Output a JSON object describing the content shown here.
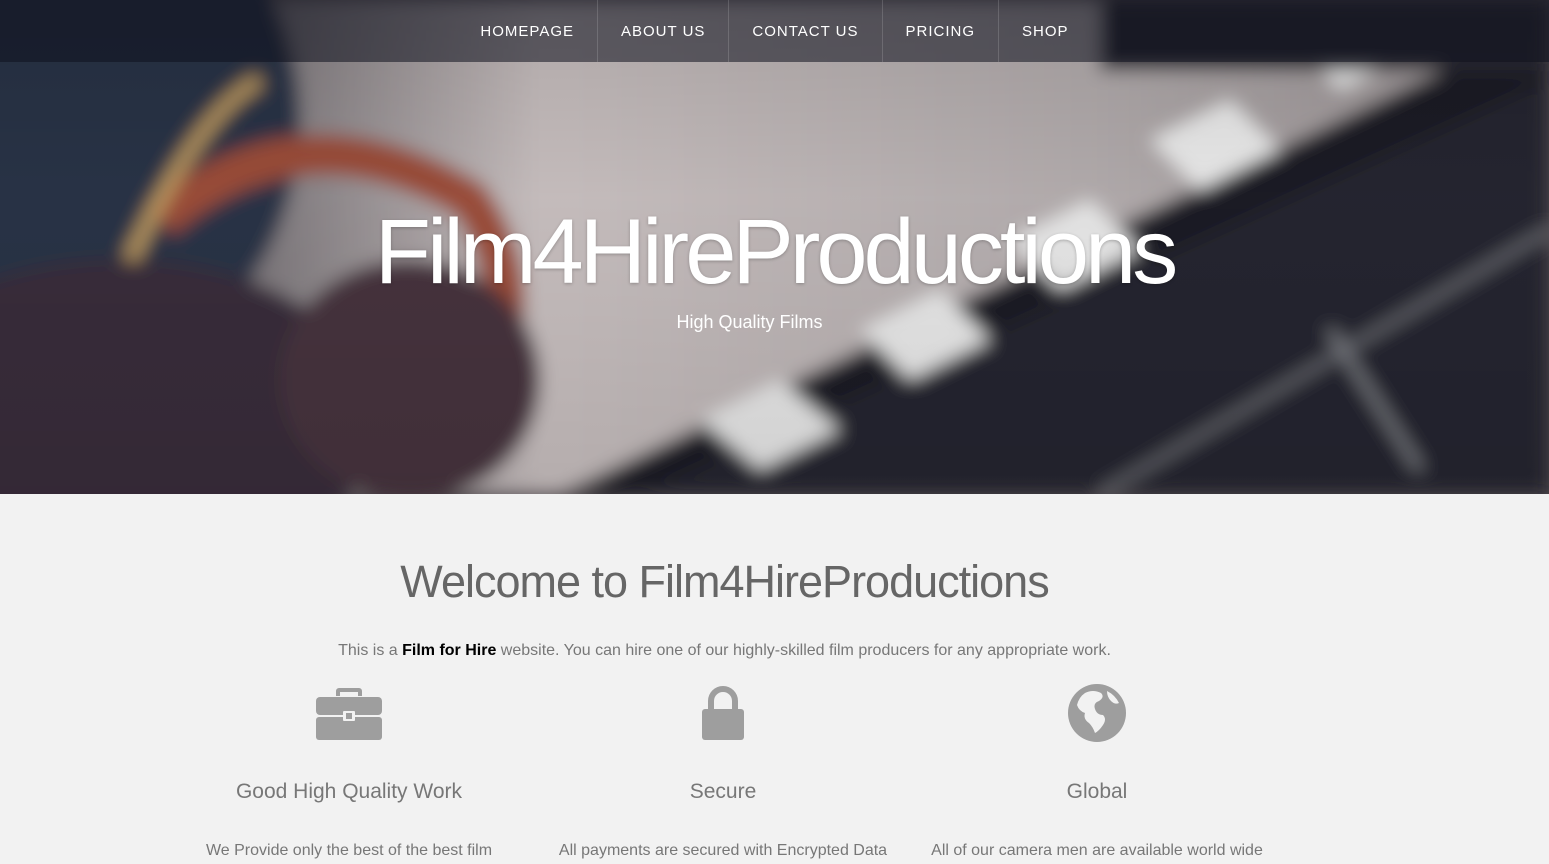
{
  "nav": {
    "items": [
      {
        "label": "HOMEPAGE"
      },
      {
        "label": "ABOUT US"
      },
      {
        "label": "CONTACT US"
      },
      {
        "label": "PRICING"
      },
      {
        "label": "SHOP"
      }
    ]
  },
  "hero": {
    "title": "Film4HireProductions",
    "subtitle": "High Quality Films"
  },
  "welcome": {
    "heading": "Welcome to Film4HireProductions",
    "intro_before": "This is a ",
    "intro_bold": "Film for Hire",
    "intro_after": " website. You can hire one of our highly-skilled film producers for any appropriate work."
  },
  "features": [
    {
      "icon": "briefcase-icon",
      "title": "Good High Quality Work",
      "text": "We Provide only the best of the best film"
    },
    {
      "icon": "lock-icon",
      "title": "Secure",
      "text": "All payments are secured with Encrypted Data"
    },
    {
      "icon": "globe-icon",
      "title": "Global",
      "text": "All of our camera men are available world wide"
    }
  ],
  "colors": {
    "icon_gray": "#9e9e9e",
    "text_gray": "#777777",
    "page_bg": "#f2f2f2"
  }
}
